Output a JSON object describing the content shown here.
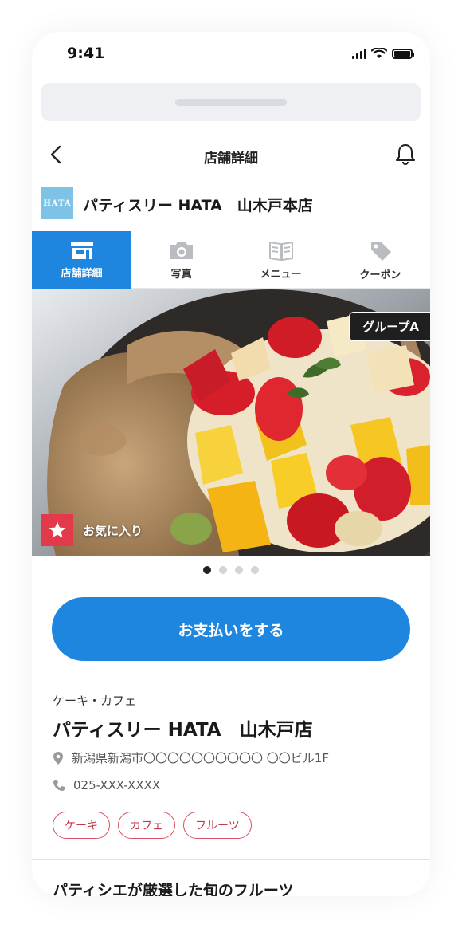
{
  "status_bar": {
    "time": "9:41"
  },
  "nav": {
    "title": "店舗詳細"
  },
  "shop": {
    "logo_text": "HATA",
    "name": "パティスリー HATA　山木戸本店"
  },
  "tabs": [
    {
      "label": "店舗詳細",
      "icon": "store-icon",
      "active": true
    },
    {
      "label": "写真",
      "icon": "camera-icon",
      "active": false
    },
    {
      "label": "メニュー",
      "icon": "menu-book-icon",
      "active": false
    },
    {
      "label": "クーポン",
      "icon": "coupon-tag-icon",
      "active": false
    }
  ],
  "hero": {
    "badge": "グループA",
    "favorite_label": "お気に入り"
  },
  "carousel": {
    "count": 4,
    "active_index": 0
  },
  "pay_button": {
    "label": "お支払いをする"
  },
  "store": {
    "category": "ケーキ・カフェ",
    "name": "パティスリー HATA　山木戸店",
    "address": "新潟県新潟市〇〇〇〇〇〇〇〇〇〇 〇〇ビル1F",
    "phone": "025-XXX-XXXX",
    "tags": [
      "ケーキ",
      "カフェ",
      "フルーツ"
    ]
  },
  "description_heading": "パティシエが厳選した旬のフルーツ",
  "colors": {
    "accent_blue": "#1f86e0",
    "favorite_red": "#e23a4a",
    "tag_red": "#d9505f"
  }
}
